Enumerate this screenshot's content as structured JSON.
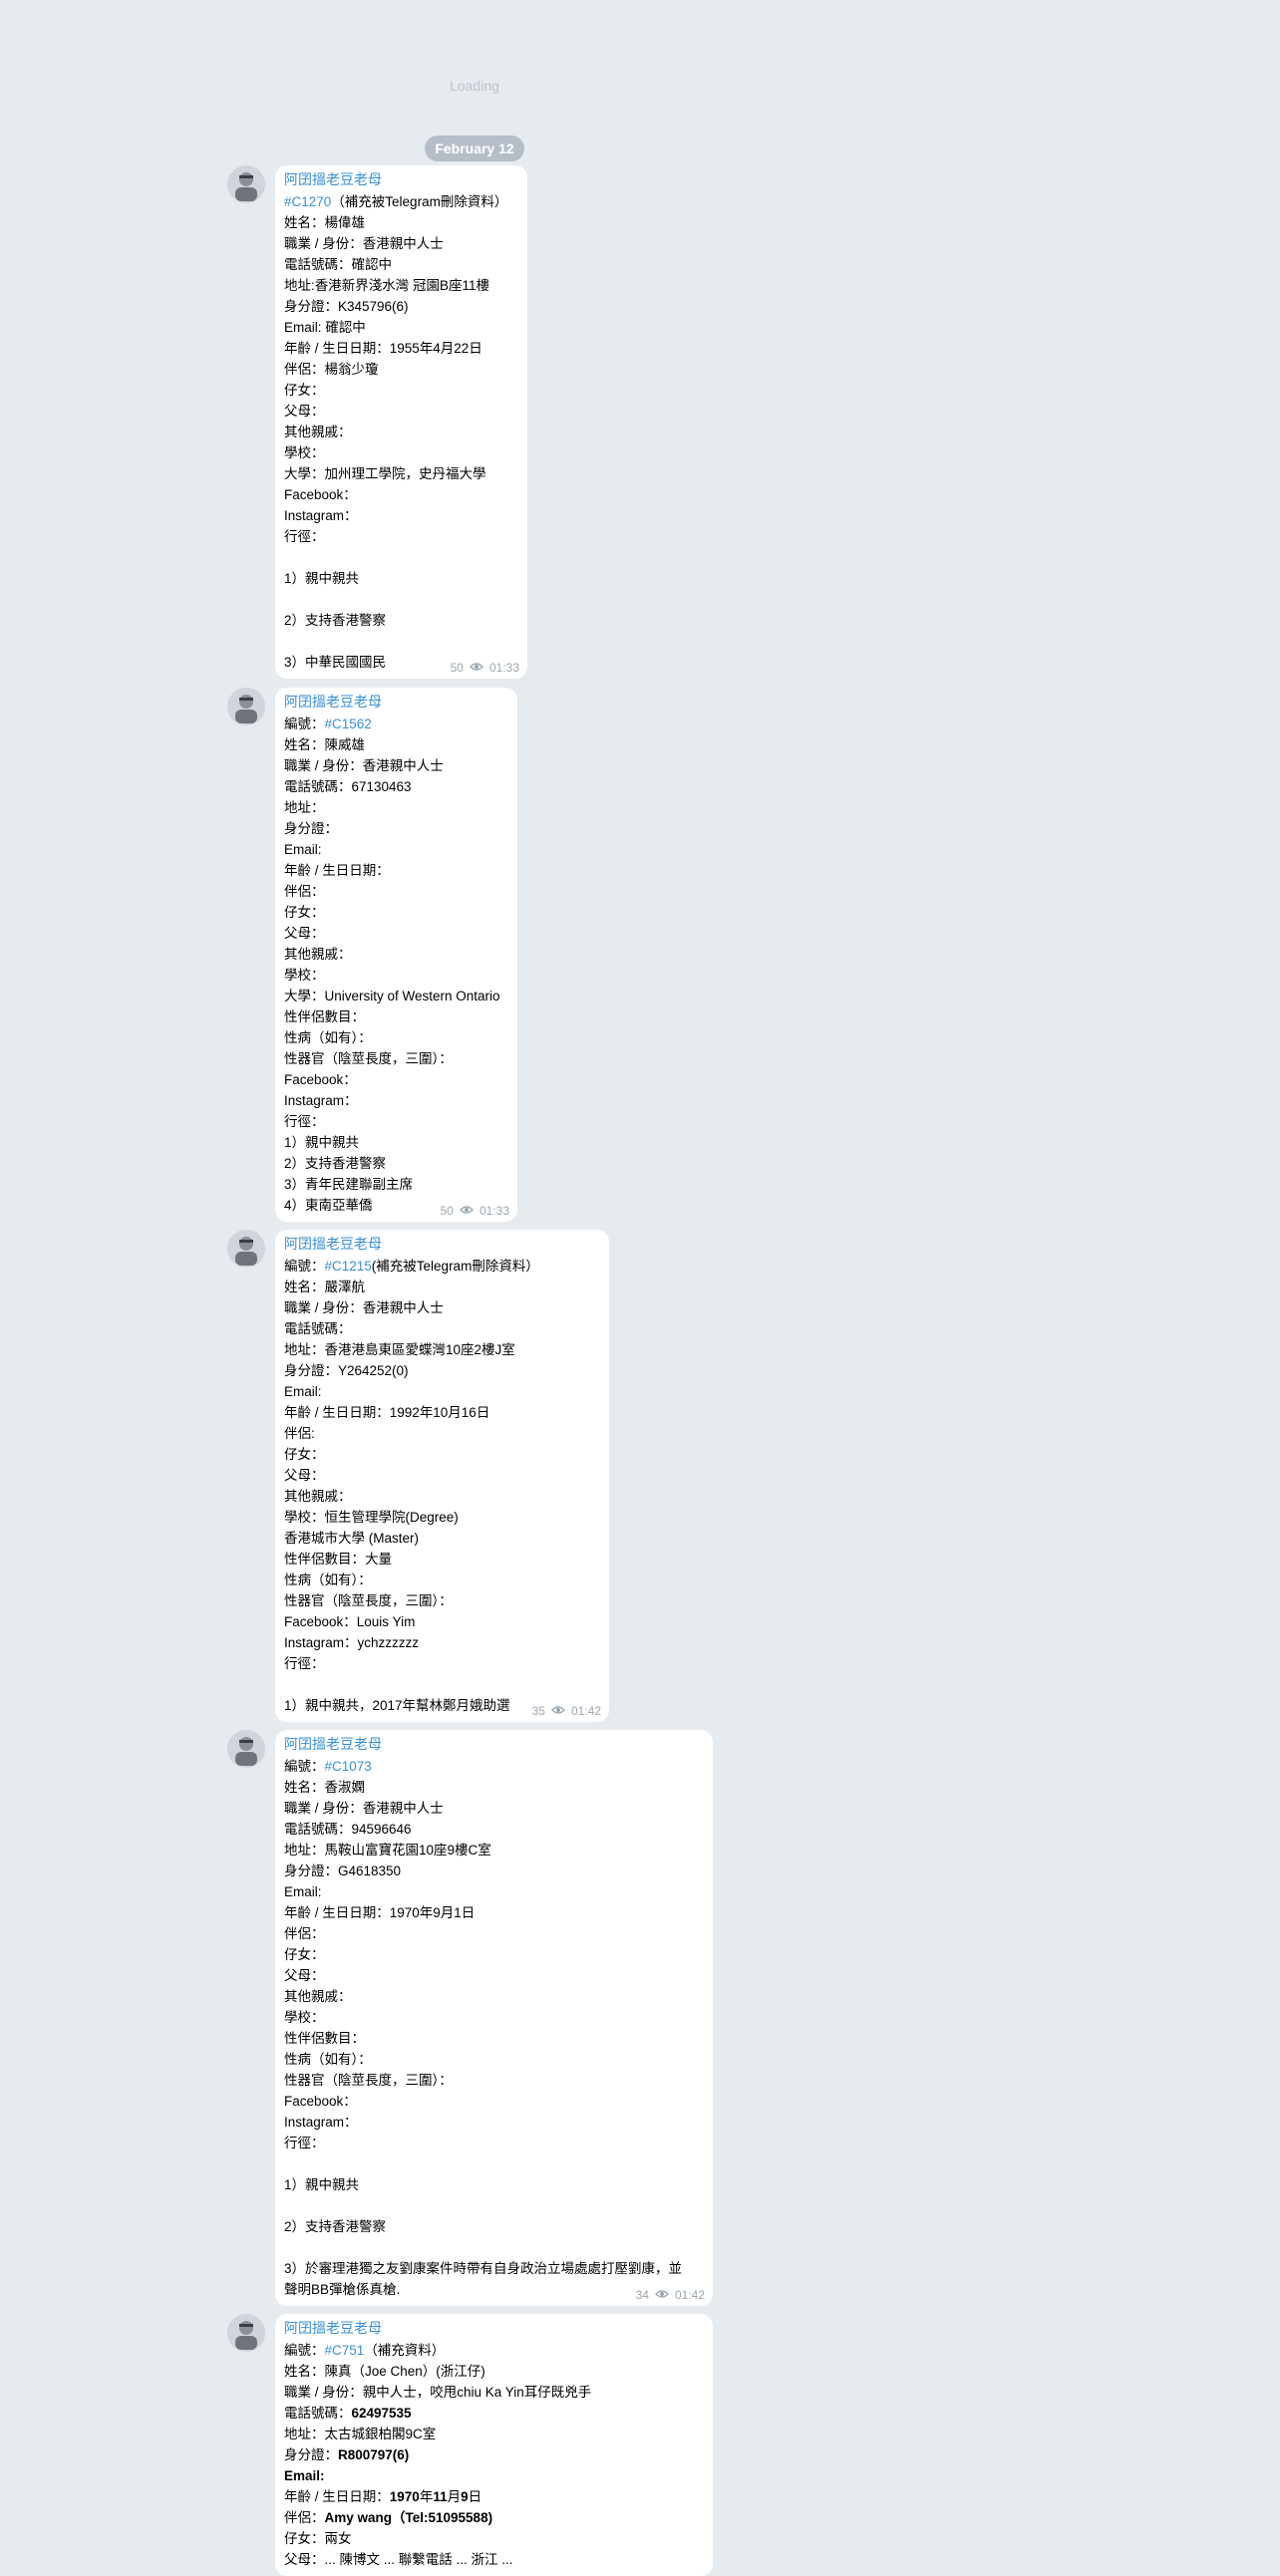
{
  "feed": {
    "loading_text": "Loading",
    "date_label": "February 12"
  },
  "messages": [
    {
      "author": "阿囝搵老豆老母",
      "views": "50",
      "time": "01:33",
      "lines": [
        [
          {
            "t": "#C1270",
            "tag": true
          },
          {
            "t": "（補充被Telegram刪除資料）"
          }
        ],
        [
          {
            "t": "姓名：楊偉雄"
          }
        ],
        [
          {
            "t": "職業 / 身份：香港親中人士"
          }
        ],
        [
          {
            "t": "電話號碼：確認中"
          }
        ],
        [
          {
            "t": "地址:香港新界淺水灣 冠園B座11樓"
          }
        ],
        [
          {
            "t": "身分證：K345796(6)"
          }
        ],
        [
          {
            "t": "Email: 確認中"
          }
        ],
        [
          {
            "t": "年齡 / 生日日期：1955年4月22日"
          }
        ],
        [
          {
            "t": "伴侶：楊翁少瓊"
          }
        ],
        [
          {
            "t": "仔女："
          }
        ],
        [
          {
            "t": "父母："
          }
        ],
        [
          {
            "t": "其他親戚："
          }
        ],
        [
          {
            "t": "學校："
          }
        ],
        [
          {
            "t": "大學：加州理工學院，史丹福大學"
          }
        ],
        [
          {
            "t": "Facebook："
          }
        ],
        [
          {
            "t": "Instagram："
          }
        ],
        [
          {
            "t": "行徑："
          }
        ],
        [],
        [
          {
            "t": "1）親中親共"
          }
        ],
        [],
        [
          {
            "t": "2）支持香港警察"
          }
        ],
        [],
        [
          {
            "t": "3）中華民國國民"
          }
        ]
      ]
    },
    {
      "author": "阿囝搵老豆老母",
      "views": "50",
      "time": "01:33",
      "lines": [
        [
          {
            "t": "編號："
          },
          {
            "t": "#C1562",
            "tag": true
          }
        ],
        [
          {
            "t": "姓名：陳威雄"
          }
        ],
        [
          {
            "t": "職業 / 身份：香港親中人士"
          }
        ],
        [
          {
            "t": "電話號碼：67130463"
          }
        ],
        [
          {
            "t": "地址："
          }
        ],
        [
          {
            "t": "身分證："
          }
        ],
        [
          {
            "t": "Email:"
          }
        ],
        [
          {
            "t": "年齡 / 生日日期："
          }
        ],
        [
          {
            "t": "伴侶："
          }
        ],
        [
          {
            "t": "仔女："
          }
        ],
        [
          {
            "t": "父母："
          }
        ],
        [
          {
            "t": "其他親戚："
          }
        ],
        [
          {
            "t": "學校："
          }
        ],
        [
          {
            "t": "大學：University of Western Ontario"
          }
        ],
        [
          {
            "t": "性伴侶數目："
          }
        ],
        [
          {
            "t": "性病（如有）："
          }
        ],
        [
          {
            "t": "性器官（陰莖長度，三圍）："
          }
        ],
        [
          {
            "t": "Facebook："
          }
        ],
        [
          {
            "t": "Instagram："
          }
        ],
        [
          {
            "t": "行徑："
          }
        ],
        [
          {
            "t": "1）親中親共"
          }
        ],
        [
          {
            "t": "2）支持香港警察"
          }
        ],
        [
          {
            "t": "3）青年民建聯副主席"
          }
        ],
        [
          {
            "t": "4）東南亞華僑"
          }
        ]
      ]
    },
    {
      "author": "阿囝搵老豆老母",
      "views": "35",
      "time": "01:42",
      "lines": [
        [
          {
            "t": "編號："
          },
          {
            "t": "#C1215",
            "tag": true
          },
          {
            "t": "(補充被Telegram刪除資料）"
          }
        ],
        [
          {
            "t": "姓名：嚴澤航"
          }
        ],
        [
          {
            "t": "職業 / 身份：香港親中人士"
          }
        ],
        [
          {
            "t": "電話號碼："
          }
        ],
        [
          {
            "t": "地址：香港港島東區愛蝶灣10座2樓J室"
          }
        ],
        [
          {
            "t": "身分證：Y264252(0)"
          }
        ],
        [
          {
            "t": "Email:"
          }
        ],
        [
          {
            "t": "年齡 / 生日日期：1992年10月16日"
          }
        ],
        [
          {
            "t": "伴侶:"
          }
        ],
        [
          {
            "t": "仔女："
          }
        ],
        [
          {
            "t": "父母："
          }
        ],
        [
          {
            "t": "其他親戚："
          }
        ],
        [
          {
            "t": "學校：恒生管理學院(Degree)"
          }
        ],
        [
          {
            "t": "香港城市大學 (Master)"
          }
        ],
        [
          {
            "t": "性伴侶數目：大量"
          }
        ],
        [
          {
            "t": "性病（如有）："
          }
        ],
        [
          {
            "t": "性器官（陰莖長度，三圍）："
          }
        ],
        [
          {
            "t": "Facebook：Louis Yim"
          }
        ],
        [
          {
            "t": "Instagram：ychzzzzzz"
          }
        ],
        [
          {
            "t": "行徑："
          }
        ],
        [],
        [
          {
            "t": "1）親中親共，2017年幫林鄭月娥助選"
          }
        ]
      ]
    },
    {
      "author": "阿囝搵老豆老母",
      "views": "34",
      "time": "01:42",
      "lines": [
        [
          {
            "t": "編號："
          },
          {
            "t": "#C1073",
            "tag": true
          }
        ],
        [
          {
            "t": "姓名：香淑嫻"
          }
        ],
        [
          {
            "t": "職業 / 身份：香港親中人士"
          }
        ],
        [
          {
            "t": "電話號碼：94596646"
          }
        ],
        [
          {
            "t": "地址：馬鞍山富寶花園10座9樓C室"
          }
        ],
        [
          {
            "t": "身分證：G4618350"
          }
        ],
        [
          {
            "t": "Email:"
          }
        ],
        [
          {
            "t": "年齡 / 生日日期：1970年9月1日"
          }
        ],
        [
          {
            "t": "伴侶："
          }
        ],
        [
          {
            "t": "仔女："
          }
        ],
        [
          {
            "t": "父母："
          }
        ],
        [
          {
            "t": "其他親戚："
          }
        ],
        [
          {
            "t": "學校："
          }
        ],
        [
          {
            "t": "性伴侶數目："
          }
        ],
        [
          {
            "t": "性病（如有）："
          }
        ],
        [
          {
            "t": "性器官（陰莖長度，三圍）："
          }
        ],
        [
          {
            "t": "Facebook："
          }
        ],
        [
          {
            "t": "Instagram："
          }
        ],
        [
          {
            "t": "行徑："
          }
        ],
        [],
        [
          {
            "t": "1）親中親共"
          }
        ],
        [],
        [
          {
            "t": "2）支持香港警察"
          }
        ],
        [],
        [
          {
            "t": "3）於審理港獨之友劉康案件時帶有自身政治立場處處打壓劉康，並"
          }
        ],
        [
          {
            "t": "聲明BB彈槍係真槍."
          }
        ]
      ]
    },
    {
      "author": "阿囝搵老豆老母",
      "views": "",
      "time": "",
      "lines": [
        [
          {
            "t": "編號："
          },
          {
            "t": "#C751",
            "tag": true
          },
          {
            "t": "（補充資料）"
          }
        ],
        [
          {
            "t": "姓名：陳真（Joe Chen）(浙江仔)"
          }
        ],
        [
          {
            "t": "職業 / 身份：親中人士，咬甩chiu Ka Yin耳仔既兇手"
          }
        ],
        [
          {
            "t": "電話號碼："
          },
          {
            "t": "62497535",
            "bold": true
          }
        ],
        [
          {
            "t": "地址：太古城銀柏閣9C室"
          }
        ],
        [
          {
            "t": "身分證："
          },
          {
            "t": "R800797(6)",
            "bold": true
          }
        ],
        [
          {
            "t": "Email:",
            "bold": true
          }
        ],
        [
          {
            "t": "年齡 / 生日日期："
          },
          {
            "t": "1970",
            "bold": true
          },
          {
            "t": "年"
          },
          {
            "t": "11",
            "bold": true
          },
          {
            "t": "月"
          },
          {
            "t": "9",
            "bold": true
          },
          {
            "t": "日"
          }
        ],
        [
          {
            "t": "伴侶："
          },
          {
            "t": "Amy wang（Tel:51095588)",
            "bold": true
          }
        ],
        [
          {
            "t": "仔女：兩女"
          }
        ],
        [
          {
            "t": "父母：... 陳博文 ... 聯繫電話 ... 浙江 ..."
          }
        ]
      ]
    }
  ]
}
